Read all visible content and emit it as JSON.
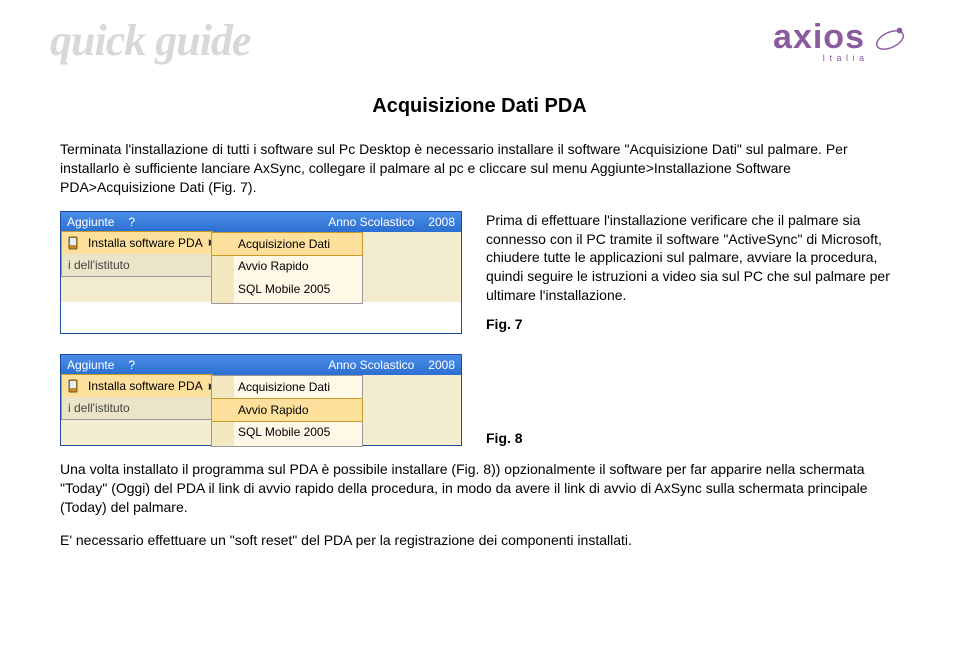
{
  "header": {
    "quick_guide": "quick guide",
    "brand": "axios",
    "brand_sub": "I t a l i a"
  },
  "doc": {
    "title": "Acquisizione Dati PDA",
    "p1": "Terminata l'installazione di tutti i software sul Pc Desktop è necessario installare il software \"Acquisizione Dati\" sul palmare. Per installarlo è sufficiente lanciare AxSync, collegare il palmare al pc e cliccare sul menu Aggiunte>Installazione Software PDA>Acquisizione Dati (Fig. 7).",
    "p2": "Prima di effettuare l'installazione verificare che il palmare sia connesso con il PC tramite il software \"ActiveSync\" di Microsoft, chiudere tutte le applicazioni sul palmare, avviare la procedura, quindi seguire le istruzioni a video sia sul PC che sul palmare per ultimare l'installazione.",
    "fig7": "Fig. 7",
    "fig8": "Fig. 8",
    "p3": "Una volta installato il programma sul PDA è possibile installare (Fig. 8)) opzionalmente il software per far apparire nella schermata \"Today\" (Oggi) del PDA il link di avvio rapido della procedura, in modo da avere il link di avvio di AxSync sulla schermata principale (Today) del palmare.",
    "p4": "E' necessario effettuare un \"soft reset\" del PDA per la registrazione dei componenti installati."
  },
  "menu": {
    "bar": {
      "aggiunte": "Aggiunte",
      "help": "?",
      "anno": "Anno Scolastico",
      "year": "2008"
    },
    "install": "Installa software PDA",
    "crumb": "i dell'istituto",
    "sub": {
      "acq": "Acquisizione Dati",
      "avvio": "Avvio Rapido",
      "sql": "SQL Mobile 2005"
    }
  }
}
